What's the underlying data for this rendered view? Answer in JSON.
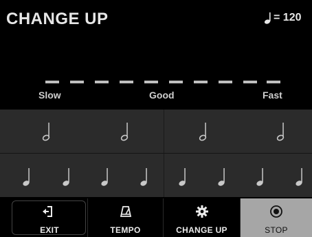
{
  "header": {
    "title": "CHANGE UP",
    "tempo_value": "= 120",
    "tempo_icon": "quarter-note-icon"
  },
  "meter": {
    "labels": {
      "slow": "Slow",
      "good": "Good",
      "fast": "Fast"
    },
    "segment_count": 10
  },
  "rows": {
    "top": {
      "note_type": "half-note",
      "note_count": 4
    },
    "bottom": {
      "note_type": "quarter-note",
      "note_count": 8
    }
  },
  "toolbar": {
    "exit": {
      "label": "EXIT",
      "icon": "exit-icon"
    },
    "tempo": {
      "label": "TEMPO",
      "icon": "metronome-icon"
    },
    "change_up": {
      "label": "CHANGE UP",
      "icon": "gear-icon"
    },
    "stop": {
      "label": "STOP",
      "icon": "stop-icon",
      "active": true
    }
  },
  "colors": {
    "background": "#000000",
    "row_background": "#2b2b2b",
    "meter_segment": "#bfbfbf",
    "active_button": "#a6a6a6",
    "text": "#e6e6e6"
  }
}
